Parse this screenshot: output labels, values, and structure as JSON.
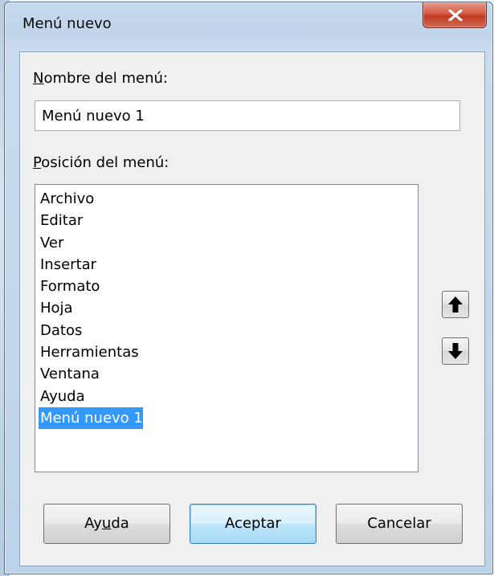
{
  "window": {
    "title": "Menú nuevo",
    "close_icon": "close-x-icon"
  },
  "name_field": {
    "label_mnemonic": "N",
    "label_rest": "ombre del menú:",
    "value": "Menú nuevo 1"
  },
  "position_field": {
    "label_mnemonic": "P",
    "label_rest": "osición del menú:",
    "items": [
      "Archivo",
      "Editar",
      "Ver",
      "Insertar",
      "Formato",
      "Hoja",
      "Datos",
      "Herramientas",
      "Ventana",
      "Ayuda",
      "Menú nuevo 1"
    ],
    "selected_item": "Menú nuevo 1",
    "move_up_icon": "arrow-up-icon",
    "move_down_icon": "arrow-down-icon"
  },
  "buttons": {
    "help_pre": "Ay",
    "help_mnemonic": "u",
    "help_post": "da",
    "ok": "Aceptar",
    "cancel": "Cancelar"
  },
  "colors": {
    "selection": "#3399ff",
    "close_button": "#c13a22",
    "frame": "#c5d9ee"
  }
}
